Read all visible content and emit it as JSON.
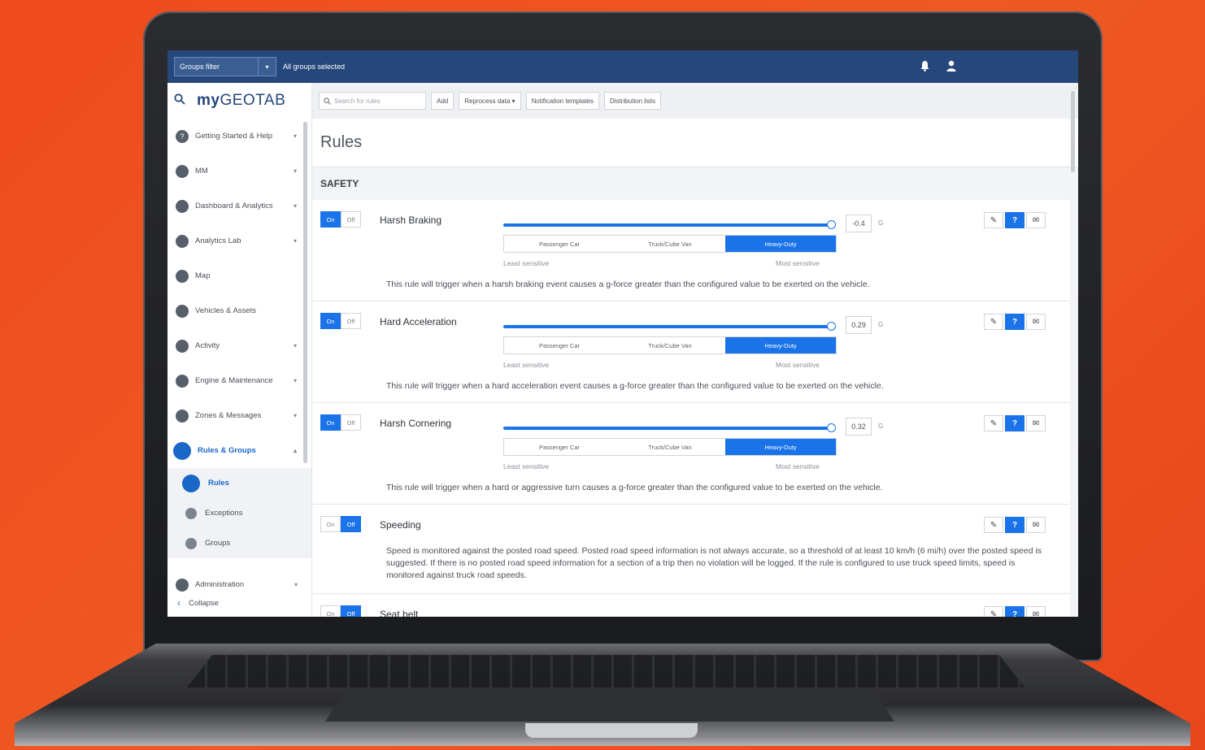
{
  "topbar": {
    "groups_filter_label": "Groups filter",
    "groups_caret": "▾",
    "groups_selected": "All groups selected",
    "bell_icon": "bell-icon",
    "user_icon": "user-icon"
  },
  "sidebar": {
    "logo_prefix": "my",
    "logo_suffix": "GEOTAB",
    "items": [
      {
        "label": "Getting Started & Help",
        "icon": "help-circle-icon",
        "chev": "▾"
      },
      {
        "label": "MM",
        "icon": "puzzle-icon",
        "chev": "▾"
      },
      {
        "label": "Dashboard & Analytics",
        "icon": "dashboard-icon",
        "chev": "▾"
      },
      {
        "label": "Analytics Lab",
        "icon": "flask-icon",
        "chev": "▾"
      },
      {
        "label": "Map",
        "icon": "map-icon",
        "chev": ""
      },
      {
        "label": "Vehicles & Assets",
        "icon": "truck-icon",
        "chev": ""
      },
      {
        "label": "Activity",
        "icon": "activity-icon",
        "chev": "▾"
      },
      {
        "label": "Engine & Maintenance",
        "icon": "engine-icon",
        "chev": "▾"
      },
      {
        "label": "Zones & Messages",
        "icon": "zones-icon",
        "chev": "▾"
      },
      {
        "label": "Rules & Groups",
        "icon": "rules-groups-icon",
        "chev": "▴"
      }
    ],
    "subitems": [
      {
        "label": "Rules",
        "icon": "rules-icon"
      },
      {
        "label": "Exceptions",
        "icon": "exceptions-icon"
      },
      {
        "label": "Groups",
        "icon": "groups-icon"
      }
    ],
    "admin_label": "Administration",
    "admin_chev": "▾",
    "collapse_label": "Collapse"
  },
  "toolbar": {
    "search_placeholder": "Search for rules",
    "add_label": "Add",
    "reprocess_label": "Reprocess data ▾",
    "notification_label": "Notification templates",
    "distribution_label": "Distribution lists"
  },
  "page": {
    "title": "Rules",
    "section": "SAFETY"
  },
  "common": {
    "on": "On",
    "off": "Off",
    "least_sensitive": "Least sensitive",
    "most_sensitive": "Most sensitive",
    "seg_passenger": "Passenger Car",
    "seg_truck": "Truck/Cube Van",
    "seg_heavy": "Heavy-Duty",
    "unit": "G",
    "help": "?"
  },
  "rules": [
    {
      "name": "Harsh Braking",
      "state": "On",
      "value": "-0.4",
      "slider_fraction": 1.0,
      "vehicle_type": "Heavy-Duty",
      "description": "This rule will trigger when a harsh braking event causes a g-force greater than the configured value to be exerted on the vehicle."
    },
    {
      "name": "Hard Acceleration",
      "state": "On",
      "value": "0.29",
      "slider_fraction": 1.0,
      "vehicle_type": "Heavy-Duty",
      "description": "This rule will trigger when a hard acceleration event causes a g-force greater than the configured value to be exerted on the vehicle."
    },
    {
      "name": "Harsh Cornering",
      "state": "On",
      "value": "0.32",
      "slider_fraction": 1.0,
      "vehicle_type": "Heavy-Duty",
      "description": "This rule will trigger when a hard or aggressive turn causes a g-force greater than the configured value to be exerted on the vehicle."
    },
    {
      "name": "Speeding",
      "state": "Off",
      "description": "Speed is monitored against the posted road speed. Posted road speed information is not always accurate, so a threshold of at least 10 km/h (6 mi/h) over the posted speed is suggested. If there is no posted road speed information for a section of a trip then no violation will be logged. If the rule is configured to use truck speed limits, speed is monitored against truck road speeds."
    },
    {
      "name": "Seat belt",
      "state": "Off"
    }
  ],
  "colors": {
    "accent": "#1a73e8",
    "topbar": "#25477b",
    "background": "#f04a1e"
  }
}
